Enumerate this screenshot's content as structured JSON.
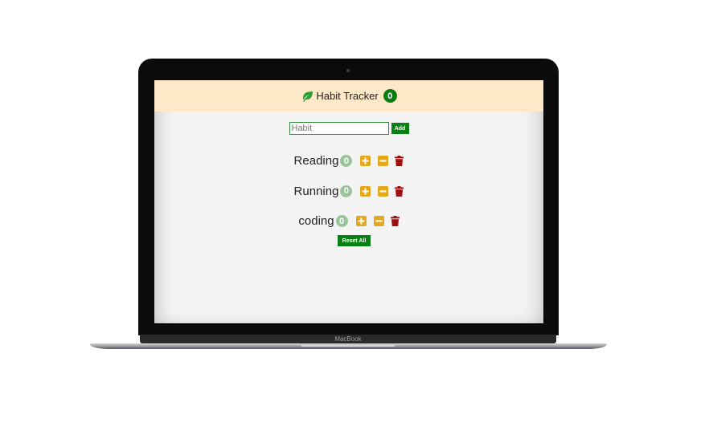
{
  "device": {
    "brand": "MacBook"
  },
  "header": {
    "title": "Habit Tracker",
    "total_count": "0"
  },
  "form": {
    "placeholder": "Habit",
    "value": "",
    "add_label": "Add"
  },
  "habits": [
    {
      "name": "Reading",
      "count": "0"
    },
    {
      "name": "Running",
      "count": "0"
    },
    {
      "name": "coding",
      "count": "0"
    }
  ],
  "reset_label": "Reset All",
  "icons": {
    "brand": "leaf-icon",
    "increment": "plus-square-icon",
    "decrement": "minus-square-icon",
    "delete": "trash-icon"
  },
  "colors": {
    "header_bg": "#fde8c7",
    "primary_green": "#098013",
    "leaf_green": "#2e9e36",
    "count_badge": "#98c49a",
    "action_yellow": "#e4a81a",
    "delete_red": "#a00d0d"
  }
}
